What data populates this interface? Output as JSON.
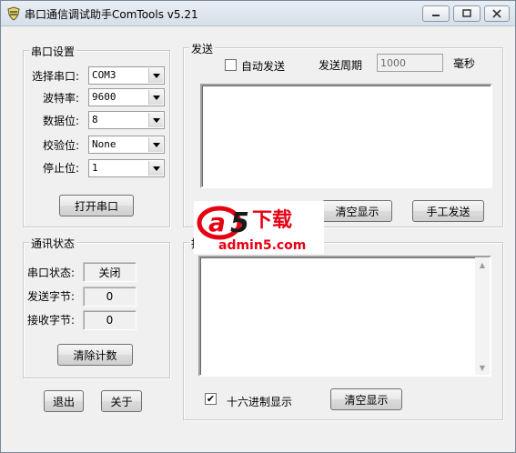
{
  "window": {
    "title": "串口通信调试助手ComTools v5.21",
    "min_icon": "minimize-icon",
    "max_icon": "maximize-icon",
    "close_icon": "close-icon"
  },
  "serial_settings": {
    "title": "串口设置",
    "port_label": "选择串口:",
    "port_value": "COM3",
    "baud_label": "波特率:",
    "baud_value": "9600",
    "databits_label": "数据位:",
    "databits_value": "8",
    "parity_label": "校验位:",
    "parity_value": "None",
    "stopbits_label": "停止位:",
    "stopbits_value": "1",
    "open_button": "打开串口"
  },
  "comm_status": {
    "title": "通讯状态",
    "port_status_label": "串口状态:",
    "port_status_value": "关闭",
    "sent_label": "发送字节:",
    "sent_value": "0",
    "recv_label": "接收字节:",
    "recv_value": "0",
    "clear_count_button": "清除计数"
  },
  "footer": {
    "exit_button": "退出",
    "about_button": "关于"
  },
  "send": {
    "title": "发送",
    "auto_send_label": "自动发送",
    "auto_send_checked": false,
    "period_label": "发送周期",
    "period_value": "1000",
    "period_unit": "毫秒",
    "clear_button": "清空显示",
    "manual_send_button": "手工发送"
  },
  "receive": {
    "title": "接",
    "hex_label": "十六进制显示",
    "hex_checked": true,
    "clear_button": "清空显示"
  },
  "watermark": {
    "brand_top": "a5下载",
    "brand_bottom": "admin5.com",
    "colors": {
      "red": "#e60012",
      "dark": "#1a1a1a"
    }
  }
}
